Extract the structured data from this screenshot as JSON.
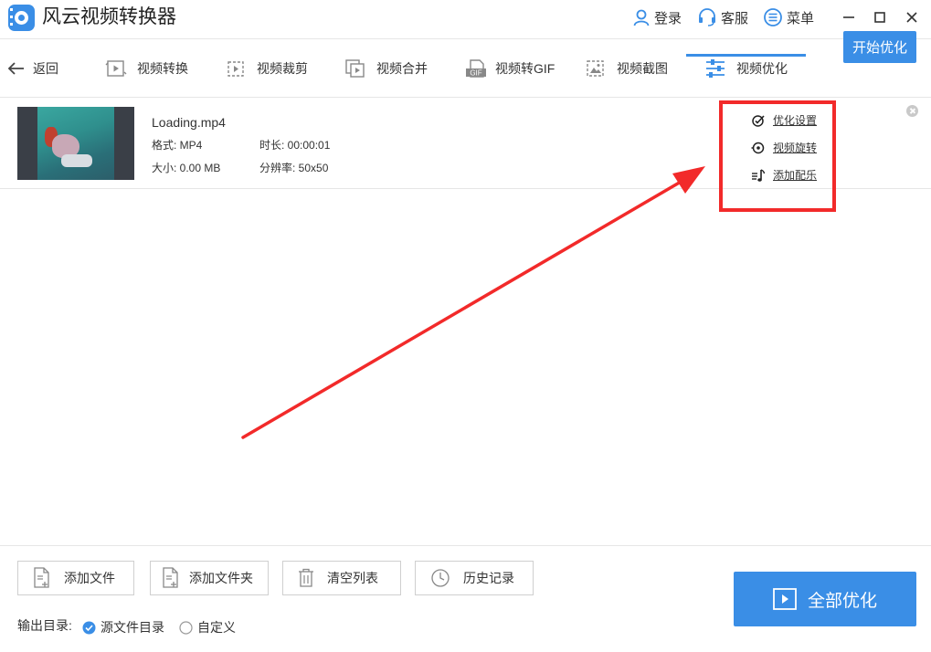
{
  "app": {
    "title": "风云视频转换器"
  },
  "titlebar": {
    "login": "登录",
    "service": "客服",
    "menu": "菜单"
  },
  "nav": {
    "back": "返回",
    "tabs": [
      "视频转换",
      "视频裁剪",
      "视频合并",
      "视频转GIF",
      "视频截图",
      "视频优化"
    ],
    "active_tab": "视频优化"
  },
  "file": {
    "name": "Loading.mp4",
    "format_label": "格式: MP4",
    "duration_label": "时长: 00:00:01",
    "size_label": "大小: 0.00 MB",
    "resolution_label": "分辨率: 50x50",
    "options": {
      "optimize_settings": "优化设置",
      "rotate": "视频旋转",
      "add_music": "添加配乐"
    },
    "start_button": "开始优化"
  },
  "bottom": {
    "add_file": "添加文件",
    "add_folder": "添加文件夹",
    "clear_list": "清空列表",
    "history": "历史记录",
    "optimize_all": "全部优化",
    "output_label": "输出目录:",
    "output_options": [
      "源文件目录",
      "自定义"
    ],
    "output_selected": "源文件目录"
  },
  "colors": {
    "accent": "#3a8ee6",
    "annotation": "#f22a2a"
  }
}
